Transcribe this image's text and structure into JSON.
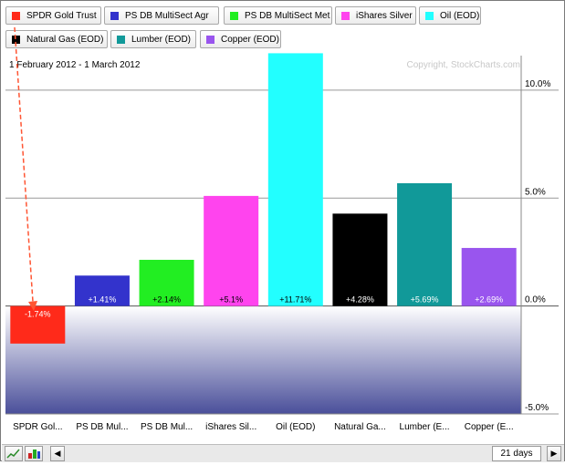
{
  "legend": {
    "items": [
      {
        "label": "SPDR Gold Trust",
        "color": "#ff2a1a"
      },
      {
        "label": "PS DB MultiSect  Agr",
        "color": "#3333cc"
      },
      {
        "label": "PS DB MultiSect Met",
        "color": "#22ee22"
      },
      {
        "label": "iShares Silver",
        "color": "#ff44ee"
      },
      {
        "label": "Oil (EOD)",
        "color": "#22ffff"
      },
      {
        "label": "Natural Gas (EOD)",
        "color": "#000000"
      },
      {
        "label": "Lumber (EOD)",
        "color": "#119999"
      },
      {
        "label": "Copper (EOD)",
        "color": "#9955ee"
      }
    ]
  },
  "header": {
    "date_range": "1 February 2012 - 1 March 2012",
    "copyright": "Copyright, StockCharts.com"
  },
  "chart_data": {
    "type": "bar",
    "categories": [
      "SPDR Gol...",
      "PS DB Mul...",
      "PS DB Mul...",
      "iShares Sil...",
      "Oil (EOD)",
      "Natural Ga...",
      "Lumber (E...",
      "Copper (E..."
    ],
    "values": [
      -1.74,
      1.41,
      2.14,
      5.1,
      11.71,
      4.28,
      5.69,
      2.69
    ],
    "value_labels": [
      "-1.74%",
      "+1.41%",
      "+2.14%",
      "+5.1%",
      "+11.71%",
      "+4.28%",
      "+5.69%",
      "+2.69%"
    ],
    "colors": [
      "#ff2a1a",
      "#3333cc",
      "#22ee22",
      "#ff44ee",
      "#22ffff",
      "#000000",
      "#119999",
      "#9955ee"
    ],
    "label_colors": [
      "#ffffff",
      "#ffffff",
      "#000000",
      "#000000",
      "#000000",
      "#ffffff",
      "#ffffff",
      "#ffffff"
    ],
    "yticks": [
      10,
      5,
      0,
      -5
    ],
    "ytick_labels": [
      "10.0%",
      "5.0%",
      "0.0%",
      "-5.0%"
    ],
    "ylim": [
      -5.0,
      11.6
    ],
    "title": "",
    "xlabel": "",
    "ylabel": ""
  },
  "toolbar": {
    "period": "21 days",
    "prev_arrow": "◀",
    "next_arrow": "▶"
  }
}
